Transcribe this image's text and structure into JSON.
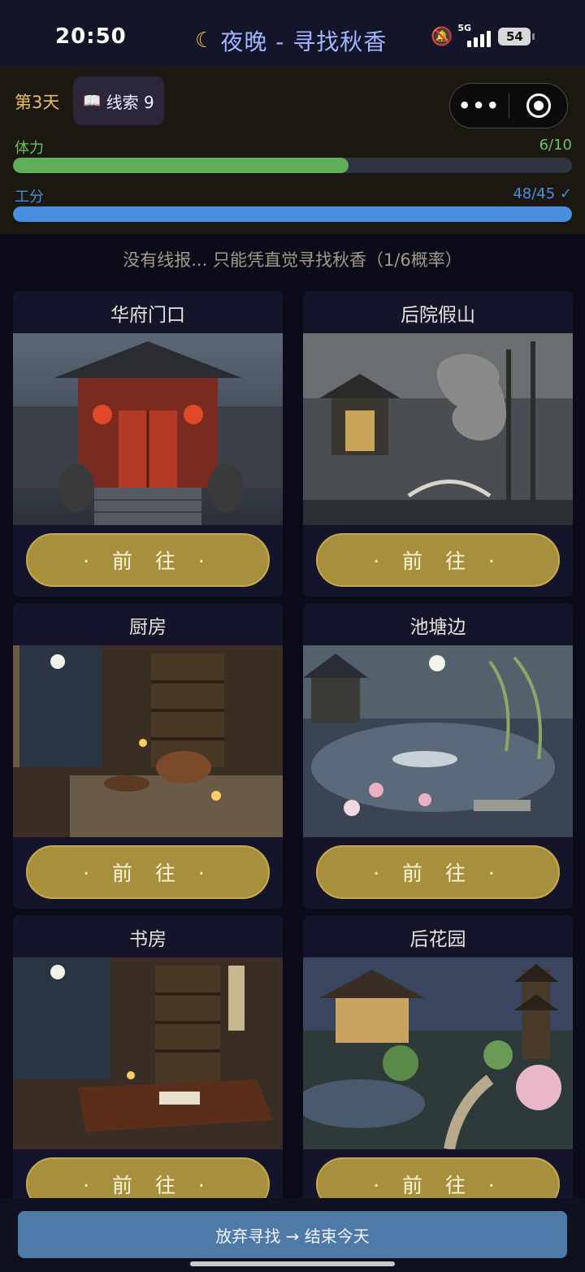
{
  "status_bar": {
    "time": "20:50",
    "title": "夜晚 - 寻找秋香",
    "network": "5G",
    "battery": "54"
  },
  "top_panel": {
    "day": "第3天",
    "clues_label": "线索 9",
    "stamina": {
      "label": "体力",
      "value": "6/10",
      "fill": 0.6,
      "color": "#5fae58"
    },
    "work_points": {
      "label": "工分",
      "value": "48/45 ✓",
      "fill": 1.0,
      "color": "#4a8ee0"
    }
  },
  "hint": "没有线报... 只能凭直觉寻找秋香（1/6概率）",
  "locations": [
    {
      "name": "华府门口",
      "button": "· 前 往 ·"
    },
    {
      "name": "后院假山",
      "button": "· 前 往 ·"
    },
    {
      "name": "厨房",
      "button": "· 前 往 ·"
    },
    {
      "name": "池塘边",
      "button": "· 前 往 ·"
    },
    {
      "name": "书房",
      "button": "· 前 往 ·"
    },
    {
      "name": "后花园",
      "button": "· 前 往 ·"
    }
  ],
  "bottom_button": "放弃寻找 → 结束今天",
  "colors": {
    "accent_gold": "#a88f3e",
    "title_blue": "#9fb6ff",
    "day_gold": "#e9c15a"
  }
}
